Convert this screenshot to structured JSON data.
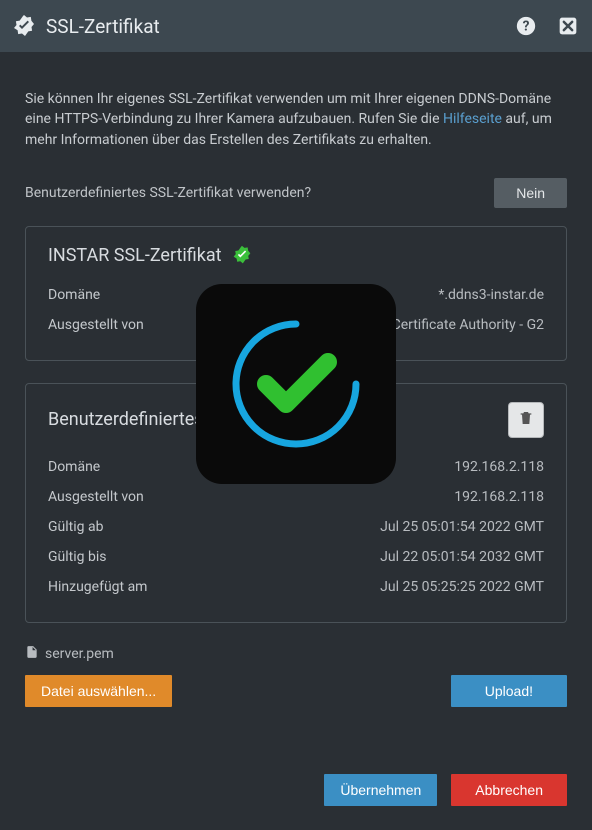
{
  "header": {
    "title": "SSL-Zertifikat"
  },
  "intro": {
    "part1": "Sie können Ihr eigenes SSL-Zertifikat verwenden um mit Ihrer eigenen DDNS-Domäne eine HTTPS-Verbindung zu Ihrer Kamera aufzubauen. Rufen Sie die ",
    "link": "Hilfeseite",
    "part2": " auf, um mehr Informationen über das Erstellen des Zertifikats zu erhalten."
  },
  "toggle": {
    "label": "Benutzerdefiniertes SSL-Zertifikat verwenden?",
    "value": "Nein"
  },
  "instar_cert": {
    "title": "INSTAR SSL-Zertifikat",
    "domain_label": "Domäne",
    "domain_value": "*.ddns3-instar.de",
    "issuer_label": "Ausgestellt von",
    "issuer_value": "Go Daddy Secure Certificate Authority - G2"
  },
  "custom_cert": {
    "title": "Benutzerdefiniertes SSL-Zertifikat",
    "domain_label": "Domäne",
    "domain_value": "192.168.2.118",
    "issuer_label": "Ausgestellt von",
    "issuer_value": "192.168.2.118",
    "valid_from_label": "Gültig ab",
    "valid_from_value": "Jul 25 05:01:54 2022 GMT",
    "valid_to_label": "Gültig bis",
    "valid_to_value": "Jul 22 05:01:54 2032 GMT",
    "added_label": "Hinzugefügt am",
    "added_value": "Jul 25 05:25:25 2022 GMT"
  },
  "file": {
    "name": "server.pem",
    "choose_label": "Datei auswählen...",
    "upload_label": "Upload!"
  },
  "footer": {
    "apply": "Übernehmen",
    "cancel": "Abbrechen"
  }
}
